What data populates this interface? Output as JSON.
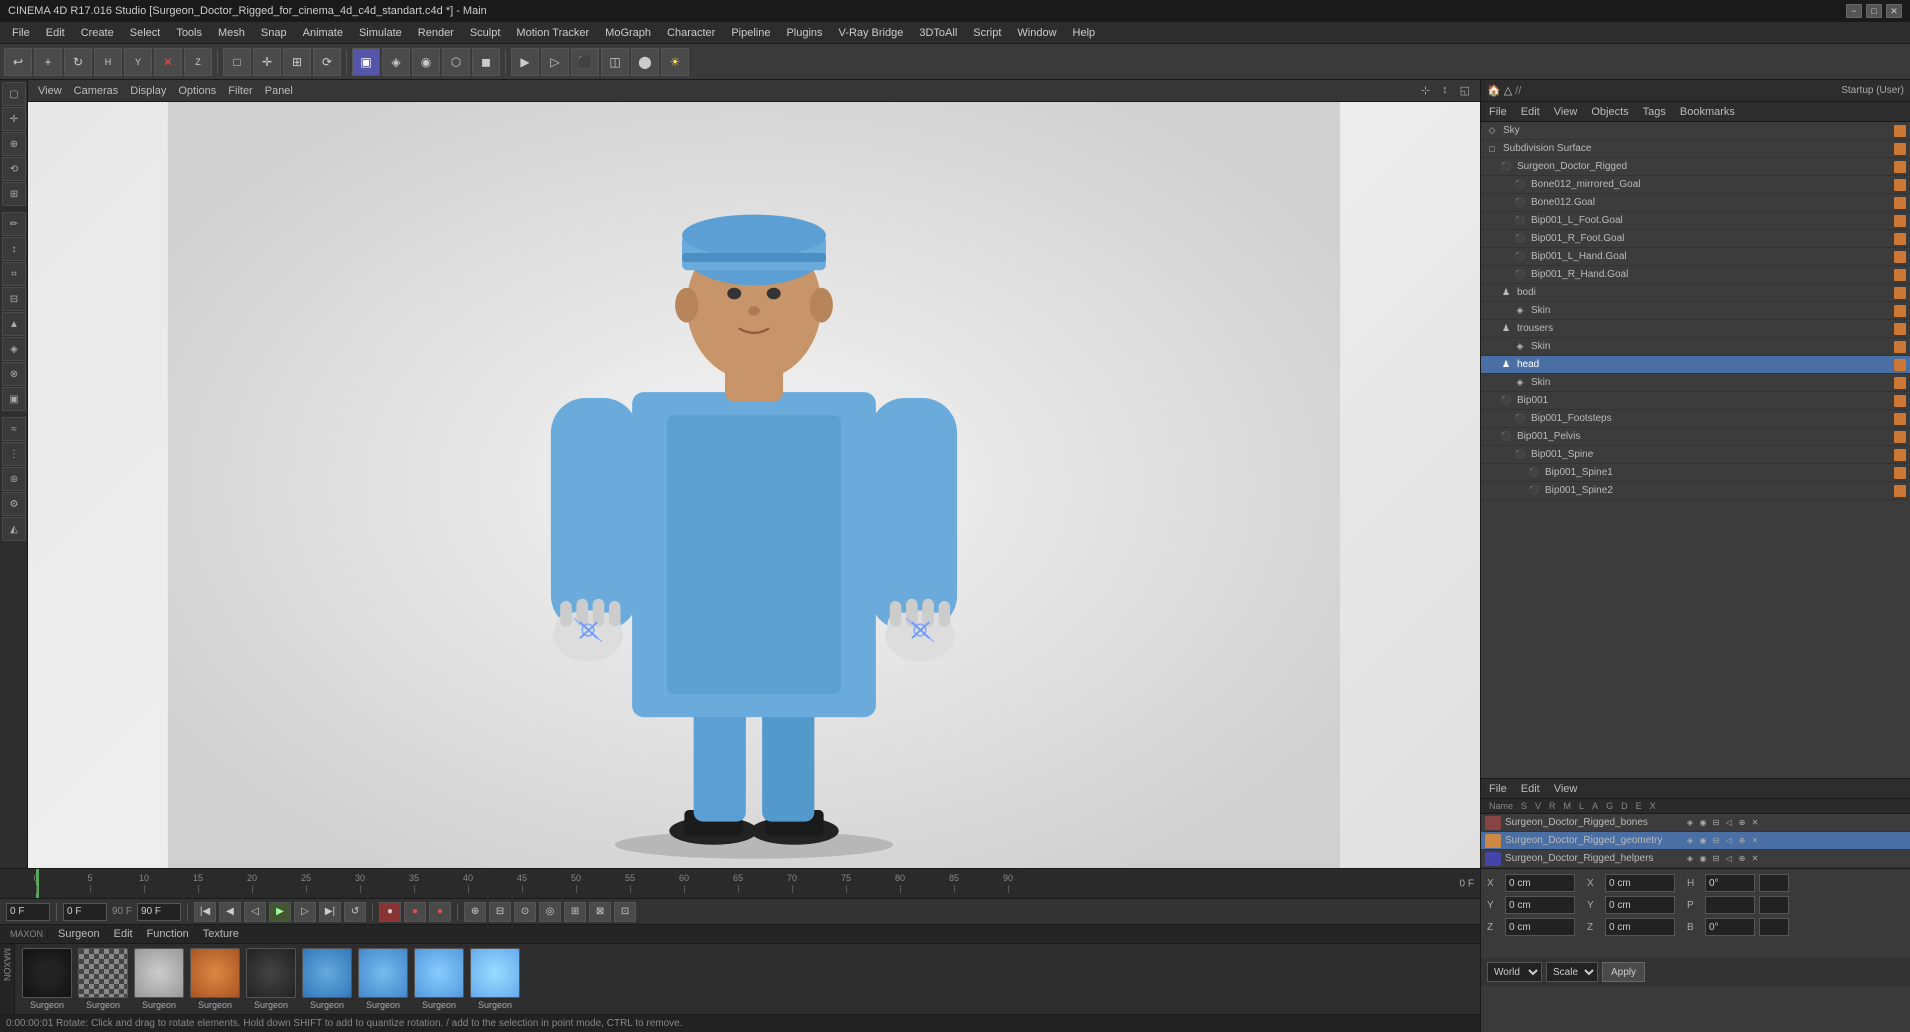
{
  "window": {
    "title": "CINEMA 4D R17.016 Studio [Surgeon_Doctor_Rigged_for_cinema_4d_c4d_standart.c4d *] - Main",
    "layout_label": "Startup (User)"
  },
  "menu": {
    "items": [
      "File",
      "Edit",
      "Create",
      "Select",
      "Tools",
      "Mesh",
      "Snap",
      "Animate",
      "Simulate",
      "Render",
      "Sculpt",
      "Motion Tracker",
      "MoGraph",
      "Character",
      "Pipeline",
      "Plugins",
      "V-Ray Bridge",
      "3DToAll",
      "Script",
      "Window",
      "Help"
    ]
  },
  "viewport": {
    "menus": [
      "View",
      "Cameras",
      "Display",
      "Options",
      "Filter",
      "Panel"
    ],
    "panel_label": "Panel"
  },
  "objects_panel": {
    "menus": [
      "File",
      "Edit",
      "View",
      "Objects",
      "Tags",
      "Bookmarks"
    ],
    "items": [
      {
        "name": "Sky",
        "level": 0,
        "icon": "◇",
        "color": "#5a8a5a"
      },
      {
        "name": "Subdivision Surface",
        "level": 0,
        "icon": "□",
        "color": "#5555cc",
        "has_x": true
      },
      {
        "name": "Surgeon_Doctor_Rigged",
        "level": 1,
        "icon": "⚫",
        "color": "#aaaaaa"
      },
      {
        "name": "Bone012_mirrored_Goal",
        "level": 2,
        "icon": "⚫",
        "color": "#aaaaaa"
      },
      {
        "name": "Bone012.Goal",
        "level": 2,
        "icon": "⚫",
        "color": "#aaaaaa"
      },
      {
        "name": "Bip001_L_Foot.Goal",
        "level": 2,
        "icon": "⚫",
        "color": "#aaaaaa"
      },
      {
        "name": "Bip001_R_Foot.Goal",
        "level": 2,
        "icon": "⚫",
        "color": "#aaaaaa"
      },
      {
        "name": "Bip001_L_Hand.Goal",
        "level": 2,
        "icon": "⚫",
        "color": "#aaaaaa"
      },
      {
        "name": "Bip001_R_Hand.Goal",
        "level": 2,
        "icon": "⚫",
        "color": "#aaaaaa"
      },
      {
        "name": "bodi",
        "level": 1,
        "icon": "♟",
        "color": "#aaaaaa"
      },
      {
        "name": "Skin",
        "level": 2,
        "icon": "◈",
        "color": "#aaaaaa"
      },
      {
        "name": "trousers",
        "level": 1,
        "icon": "♟",
        "color": "#aaaaaa"
      },
      {
        "name": "Skin",
        "level": 2,
        "icon": "◈",
        "color": "#aaaaaa"
      },
      {
        "name": "head",
        "level": 1,
        "icon": "♟",
        "color": "#aaaaaa",
        "selected": true
      },
      {
        "name": "Skin",
        "level": 2,
        "icon": "◈",
        "color": "#aaaaaa"
      },
      {
        "name": "Bip001",
        "level": 1,
        "icon": "⚫",
        "color": "#aaaaaa"
      },
      {
        "name": "Bip001_Footsteps",
        "level": 2,
        "icon": "⚫",
        "color": "#aaaaaa"
      },
      {
        "name": "Bip001_Pelvis",
        "level": 1,
        "icon": "⚫",
        "color": "#aaaaaa"
      },
      {
        "name": "Bip001_Spine",
        "level": 2,
        "icon": "⚫",
        "color": "#aaaaaa"
      },
      {
        "name": "Bip001_Spine1",
        "level": 3,
        "icon": "⚫",
        "color": "#aaaaaa"
      },
      {
        "name": "Bip001_Spine2",
        "level": 3,
        "icon": "⚫",
        "color": "#aaaaaa"
      }
    ]
  },
  "attributes_panel": {
    "menus": [
      "File",
      "Edit",
      "View"
    ],
    "columns": [
      "Name",
      "S",
      "V",
      "R",
      "M",
      "L",
      "A",
      "G",
      "D",
      "E",
      "X"
    ],
    "rows": [
      {
        "name": "Surgeon_Doctor_Rigged_bones",
        "color": "#884444",
        "selected": false
      },
      {
        "name": "Surgeon_Doctor_Rigged_geometry",
        "color": "#cc8844",
        "selected": true
      },
      {
        "name": "Surgeon_Doctor_Rigged_helpers",
        "color": "#4444aa",
        "selected": false
      }
    ]
  },
  "timeline": {
    "markers": [
      0,
      5,
      10,
      15,
      20,
      25,
      30,
      35,
      40,
      45,
      50,
      55,
      60,
      65,
      70,
      75,
      80,
      85,
      90
    ],
    "current_frame": "0 F",
    "end_frame": "90 F",
    "start_frame": "0 F"
  },
  "transport": {
    "current_frame": "0 F",
    "start_frame": "0 F",
    "end_frame": "90 F"
  },
  "coordinates": {
    "x_label": "X",
    "y_label": "Y",
    "z_label": "Z",
    "x_val": "0 cm",
    "y_val": "0 cm",
    "z_val": "0 cm",
    "x2_label": "X",
    "y2_label": "Y",
    "z2_label": "Z",
    "x2_val": "0 cm",
    "y2_val": "0 cm",
    "z2_val": "0 cm",
    "h_label": "H",
    "p_label": "P",
    "b_label": "B",
    "h_val": "0°",
    "p_val": "",
    "b_val": "0°",
    "world_label": "World",
    "scale_label": "Scale",
    "apply_label": "Apply"
  },
  "materials": [
    {
      "name": "Surgeon",
      "type": "diffuse",
      "color": "#222222"
    },
    {
      "name": "Surgeon",
      "type": "checker",
      "color": "#888888"
    },
    {
      "name": "Surgeon",
      "type": "sphere_gray",
      "color": "#aaaaaa"
    },
    {
      "name": "Surgeon",
      "type": "sphere_orange",
      "color": "#cc7733"
    },
    {
      "name": "Surgeon",
      "type": "sphere_dark",
      "color": "#333333"
    },
    {
      "name": "Surgeon",
      "type": "sphere_blue",
      "color": "#4488cc"
    },
    {
      "name": "Surgeon",
      "type": "sphere_blue2",
      "color": "#5599dd"
    },
    {
      "name": "Surgeon",
      "type": "sphere_blue3",
      "color": "#66aaee"
    },
    {
      "name": "Surgeon",
      "type": "sphere_blue4",
      "color": "#77bbff"
    }
  ],
  "status_bar": {
    "text": "0:00:00:01   Rotate: Click and drag to rotate elements. Hold down SHIFT to add to quantize rotation. / add to the selection in point mode, CTRL to remove."
  }
}
